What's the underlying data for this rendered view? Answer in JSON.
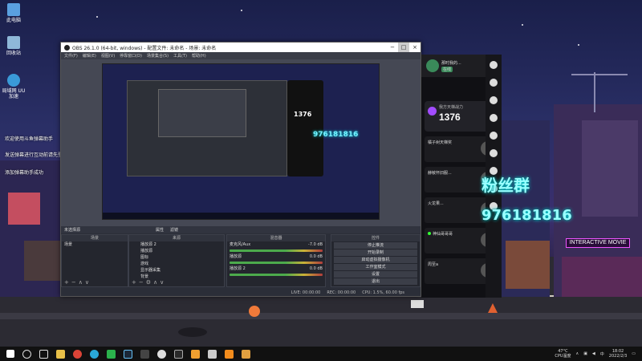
{
  "desktop": {
    "icons": [
      {
        "label": "此电脑",
        "icon": "computer-icon"
      },
      {
        "label": "回收站",
        "icon": "recycle-bin-icon"
      },
      {
        "label": "局域网 UU加速",
        "icon": "uu-accelerator-icon"
      }
    ],
    "overlay_lines": [
      "欢迎使用斗鱼弹幕助手",
      "发送弹幕进行互动前请先登录斗鱼账号",
      "添加弹幕助手成功"
    ],
    "fan_group_title": "粉丝群",
    "fan_group_number": "976181816",
    "sign_text": "INTERACTIVE MOVIE"
  },
  "obs": {
    "title": "OBS 26.1.0 (64-bit, windows) - 配置文件: 未命名 - 场景: 未命名",
    "menu": [
      "文件(F)",
      "编辑(E)",
      "视图(V)",
      "停靠窗口(D)",
      "场景集合(S)",
      "工具(T)",
      "帮助(H)"
    ],
    "source_toolbar": [
      "未选择源",
      "属性",
      "滤镜"
    ],
    "docks": {
      "scenes": {
        "title": "场景",
        "items": [
          "场景"
        ]
      },
      "sources": {
        "title": "来源",
        "items": [
          "播放源 2",
          "播放源",
          "图标",
          "游戏",
          "显示器采集",
          "背景"
        ]
      },
      "mixer": {
        "title": "混音器",
        "items": [
          {
            "name": "麦克风/Aux",
            "db": "-7.0 dB"
          },
          {
            "name": "播放源",
            "db": "0.0 dB"
          },
          {
            "name": "播放源 2",
            "db": "0.0 dB"
          }
        ]
      },
      "controls": {
        "title": "控件",
        "items": [
          "停止推流",
          "开始录制",
          "启动虚拟摄像机",
          "工作室模式",
          "设置",
          "退出"
        ]
      }
    },
    "status": [
      "LIVE: 00:00:00",
      "REC: 00:00:00",
      "CPU: 1.5%, 60.00 fps"
    ],
    "inner_chat_number": "1376",
    "inner_qq": "976181816"
  },
  "chat": {
    "header_name": "那时我的...",
    "header_badge": "在线",
    "card_label": "我方天梯战力",
    "card_value": "1376",
    "items": [
      "橘子树天梯奖",
      "赫敏怀旧服...",
      "火龙果...",
      "神仙哥哥哥",
      "周至a"
    ]
  },
  "taskbar": {
    "weather": "47°C",
    "weather_sub": "CPU温度",
    "time": "18:02",
    "date": "2022/2/3"
  },
  "colors": {
    "accent": "#a24cff",
    "fan_text": "#9ff"
  }
}
